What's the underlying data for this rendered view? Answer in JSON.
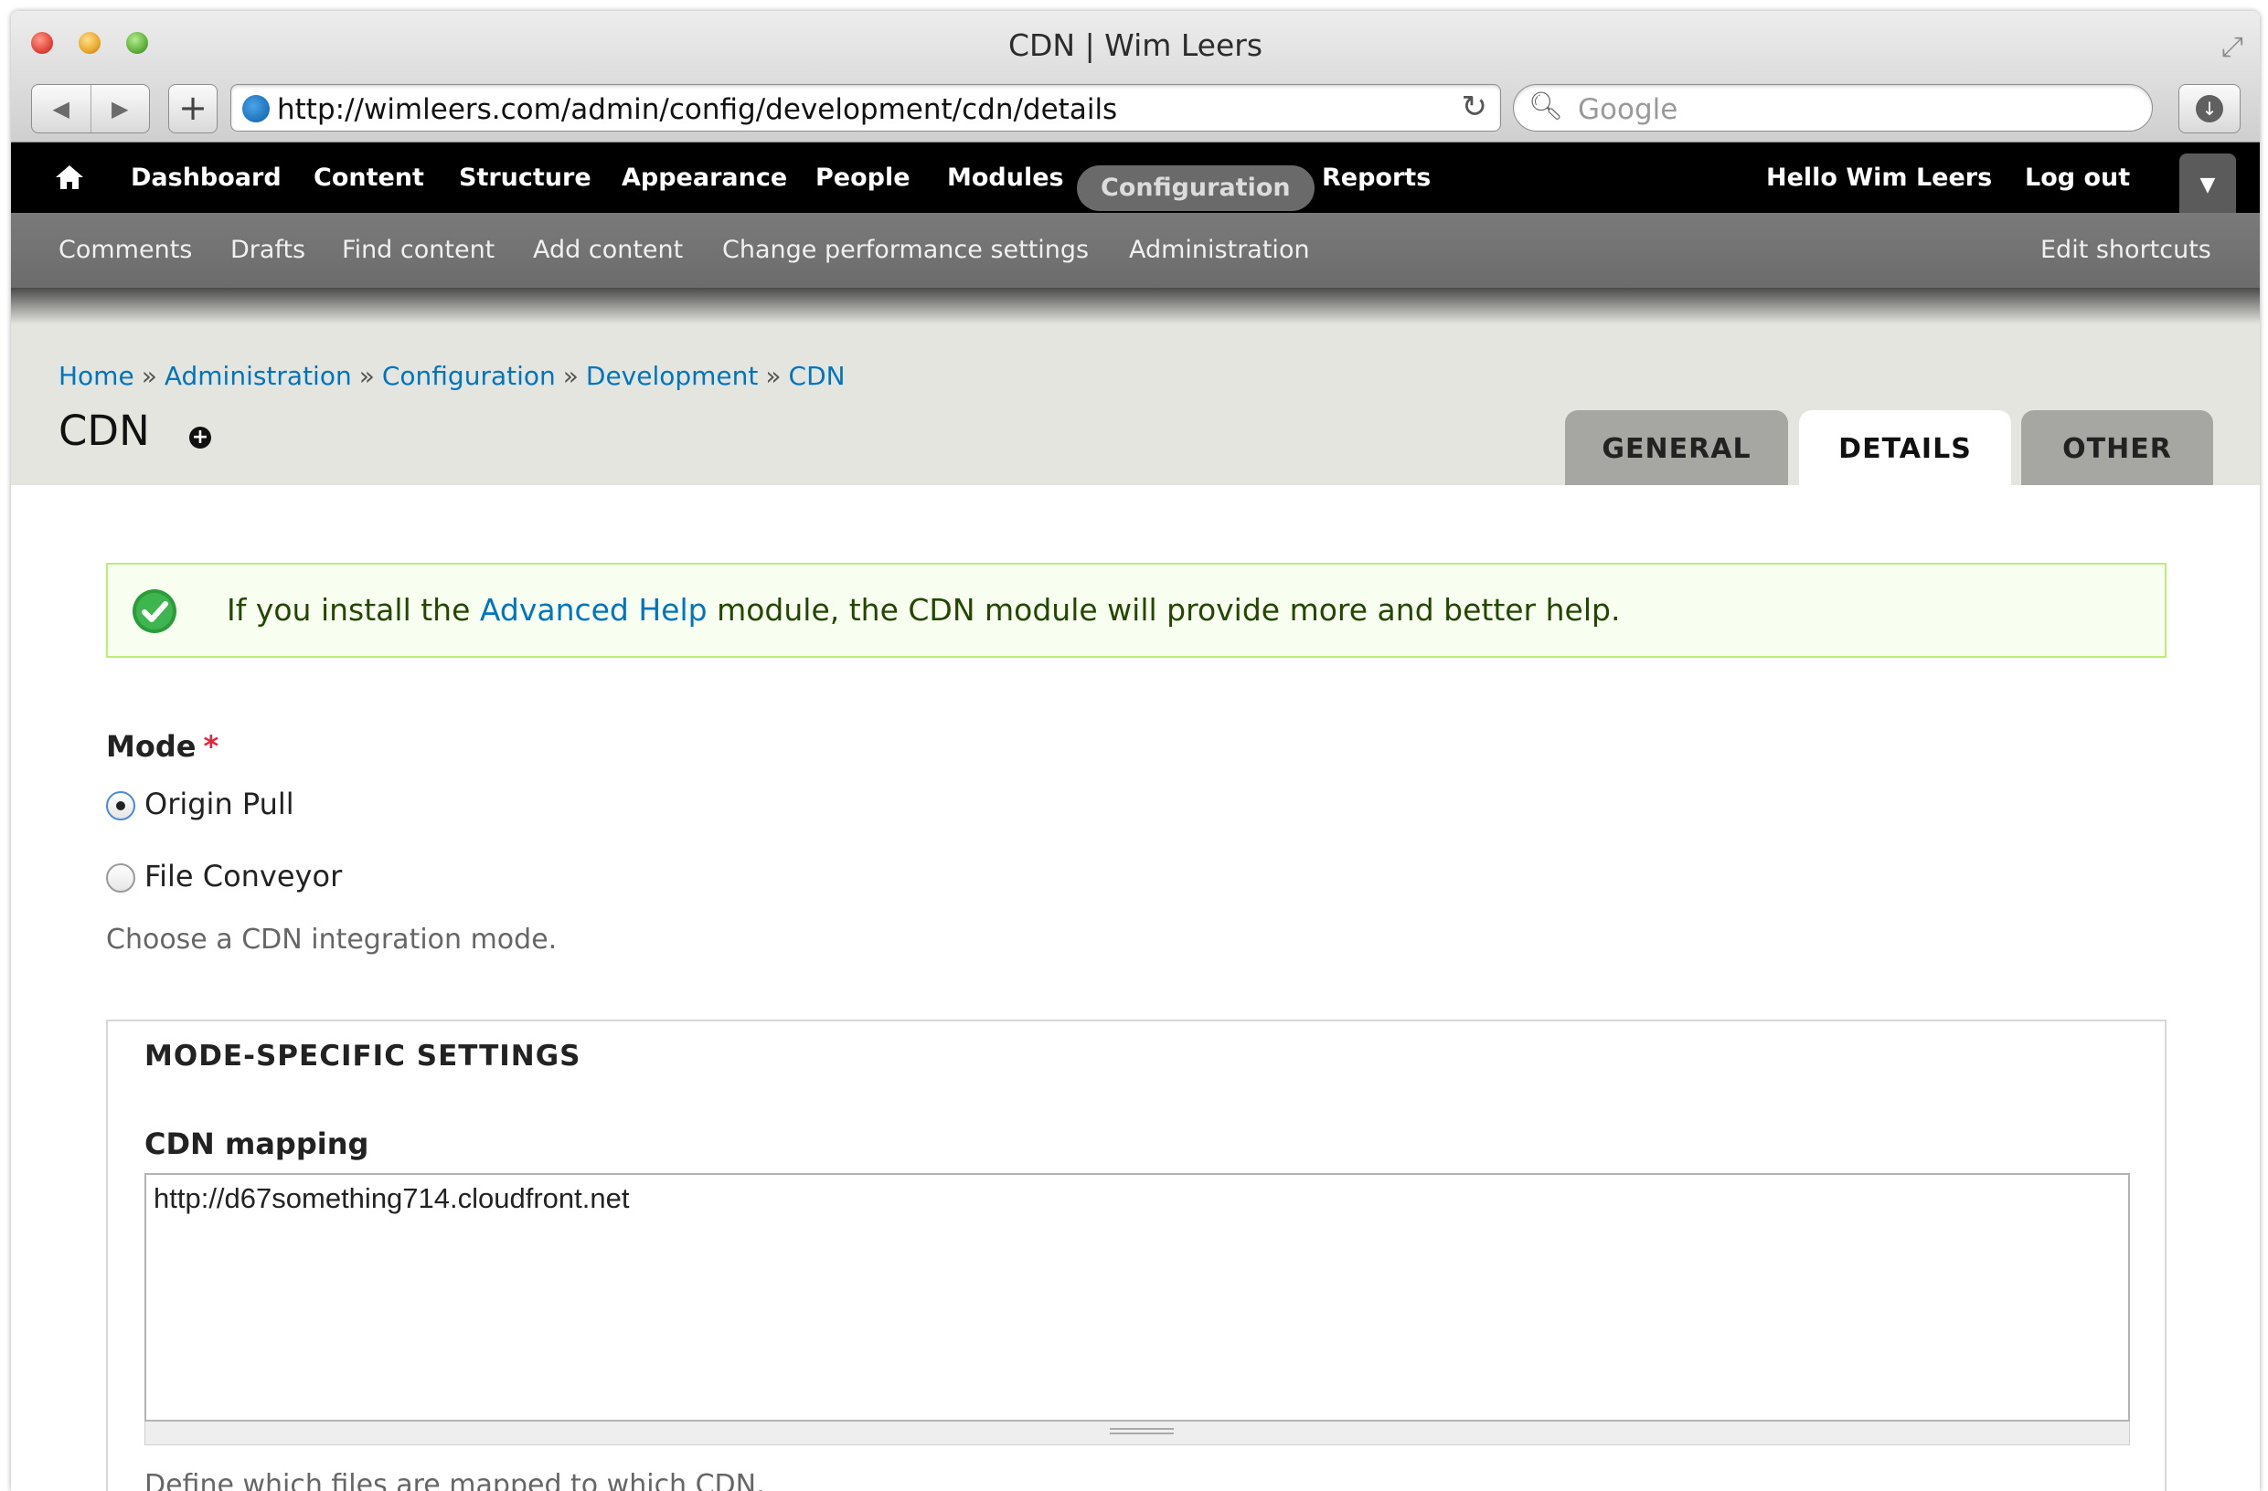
{
  "browser": {
    "window_title": "CDN | Wim Leers",
    "url": "http://wimleers.com/admin/config/development/cdn/details",
    "search_placeholder": "Google"
  },
  "toolbar": {
    "items": [
      "Dashboard",
      "Content",
      "Structure",
      "Appearance",
      "People",
      "Modules",
      "Configuration",
      "Reports"
    ],
    "active_item": "Configuration",
    "greeting_prefix": "Hello ",
    "user_name": "Wim Leers",
    "logout": "Log out"
  },
  "shortcuts": {
    "items": [
      "Comments",
      "Drafts",
      "Find content",
      "Add content",
      "Change performance settings",
      "Administration"
    ],
    "edit": "Edit shortcuts"
  },
  "breadcrumb": [
    "Home",
    "Administration",
    "Configuration",
    "Development",
    "CDN"
  ],
  "breadcrumb_separator": "»",
  "page": {
    "title": "CDN",
    "tabs": [
      "GENERAL",
      "DETAILS",
      "OTHER"
    ],
    "active_tab": "DETAILS"
  },
  "status": {
    "before": "If you install the ",
    "link": "Advanced Help",
    "after": " module, the CDN module will provide more and better help."
  },
  "mode": {
    "label": "Mode",
    "required_marker": "*",
    "options": [
      "Origin Pull",
      "File Conveyor"
    ],
    "selected": "Origin Pull",
    "description": "Choose a CDN integration mode."
  },
  "fieldset": {
    "legend": "MODE-SPECIFIC SETTINGS",
    "mapping_label": "CDN mapping",
    "mapping_value": "http://d67something714.cloudfront.net",
    "mapping_description": "Define which files are mapped to which CDN."
  },
  "colors": {
    "link": "#0074bd",
    "toolbar_bg": "#000000",
    "shortcut_bg": "#707070",
    "status_bg": "#f8fff0",
    "status_border": "#bbee77",
    "required": "#e0283c"
  }
}
